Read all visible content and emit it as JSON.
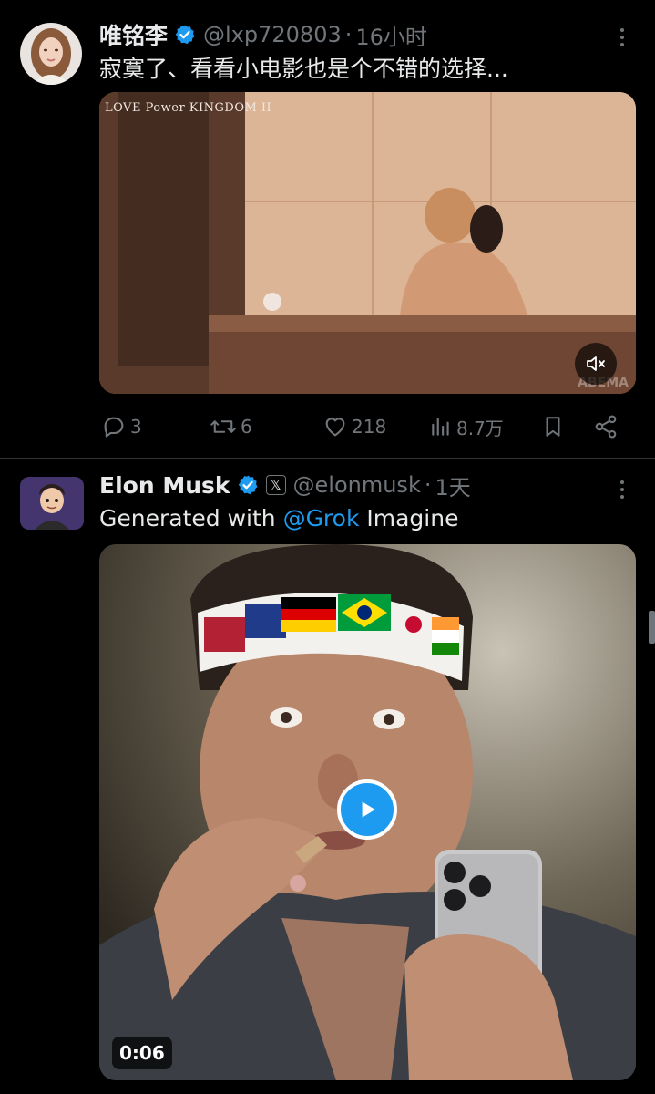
{
  "tweets": [
    {
      "author_name": "唯铭李",
      "handle": "@lxp720803",
      "separator": "·",
      "time": "16小时",
      "text": "寂寞了、看看小电影也是个不错的选择...",
      "media": {
        "watermark": "LOVE Power KINGDOM II",
        "corner_mark": "ABEMA",
        "mute_icon": "speaker-muted-icon"
      },
      "actions": {
        "replies": "3",
        "reposts": "6",
        "likes": "218",
        "views": "8.7万"
      }
    },
    {
      "author_name": "Elon Musk",
      "x_badge": "𝕏",
      "handle": "@elonmusk",
      "separator": "·",
      "time": "1天",
      "text_before": "Generated with ",
      "mention": "@Grok",
      "text_after": " Imagine",
      "media": {
        "duration": "0:06",
        "play_icon": "play-icon"
      }
    }
  ],
  "colors": {
    "background": "#000000",
    "text": "#e7e9ea",
    "muted": "#71767b",
    "accent": "#1d9bf0"
  }
}
